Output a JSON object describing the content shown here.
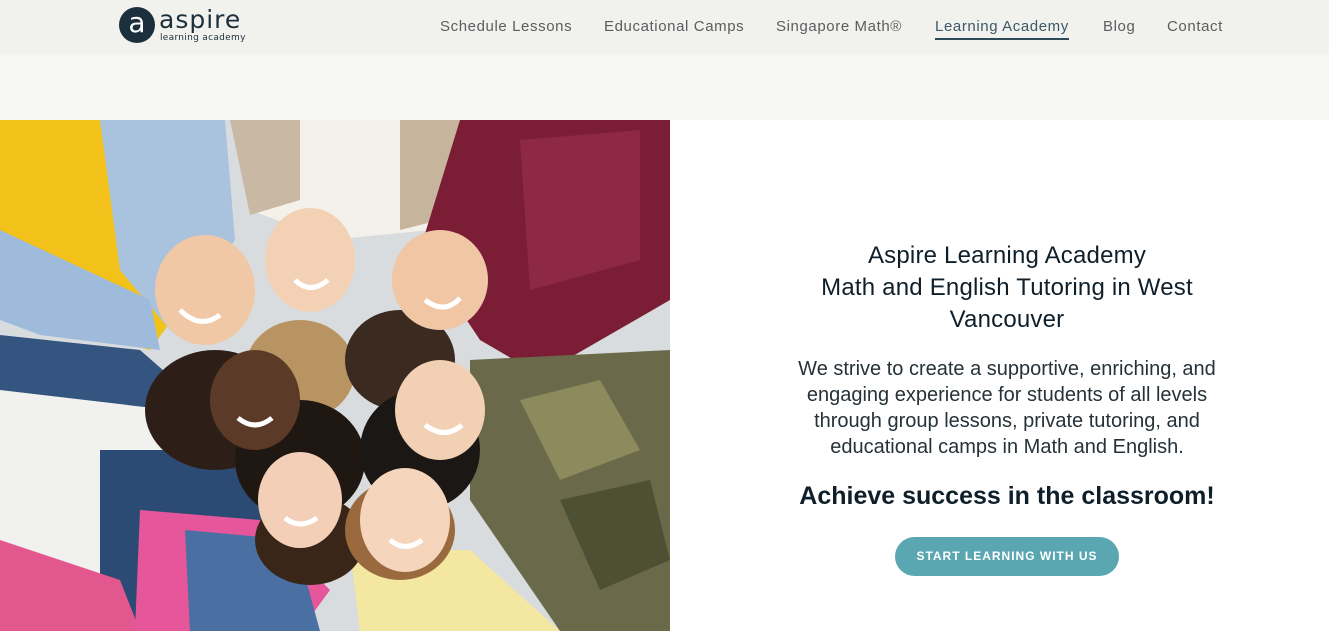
{
  "brand": {
    "mark": "a",
    "name": "aspire",
    "tagline": "learning academy",
    "color": "#1b2f3c"
  },
  "nav": {
    "items": [
      {
        "label": "Schedule Lessons",
        "active": false
      },
      {
        "label": "Educational Camps",
        "active": false
      },
      {
        "label": "Singapore Math®",
        "active": false
      },
      {
        "label": "Learning Academy",
        "active": true
      },
      {
        "label": "Blog",
        "active": false
      },
      {
        "label": "Contact",
        "active": false
      }
    ]
  },
  "hero": {
    "title_line1": "Aspire Learning Academy",
    "title_line2": "Math and English Tutoring in West Vancouver",
    "description": "We strive to create a supportive, enriching, and engaging experience for students of all levels through group lessons, private tutoring, and educational camps in Math and English.",
    "tagline": "Achieve success in the classroom!",
    "cta_label": "START LEARNING WITH US",
    "accent_color": "#5aa6b1"
  }
}
